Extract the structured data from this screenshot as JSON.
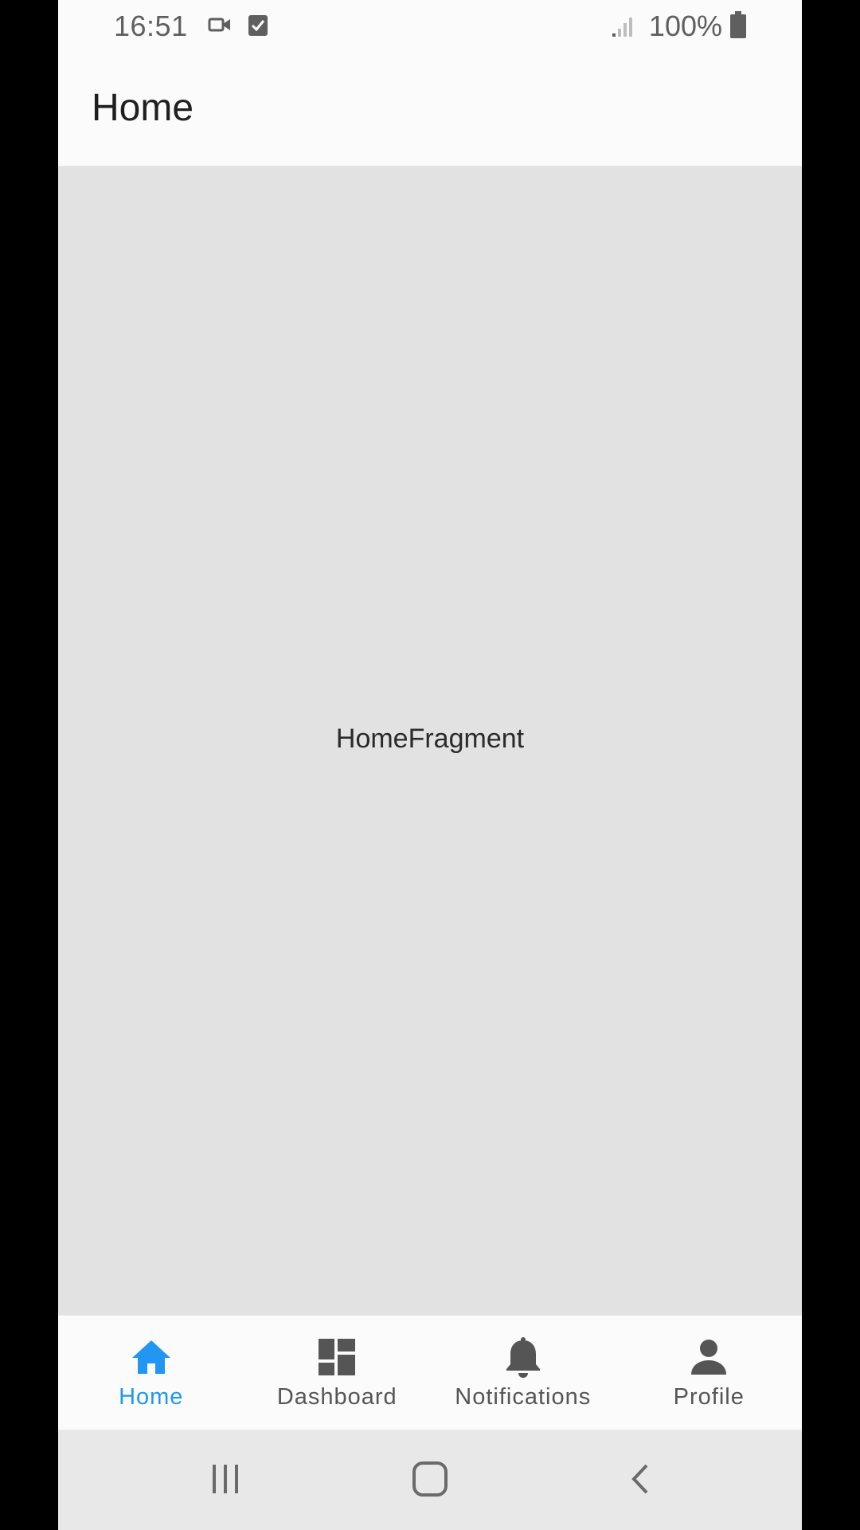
{
  "status_bar": {
    "time": "16:51",
    "battery_percent": "100%",
    "icons": [
      "video-camera-icon",
      "checkbox-icon",
      "signal-icon",
      "battery-icon"
    ]
  },
  "app_bar": {
    "title": "Home"
  },
  "content": {
    "label": "HomeFragment"
  },
  "bottom_nav": {
    "items": [
      {
        "label": "Home",
        "icon": "home-icon",
        "active": true
      },
      {
        "label": "Dashboard",
        "icon": "dashboard-icon",
        "active": false
      },
      {
        "label": "Notifications",
        "icon": "bell-icon",
        "active": false
      },
      {
        "label": "Profile",
        "icon": "person-icon",
        "active": false
      }
    ]
  },
  "system_nav": {
    "buttons": [
      "recent-apps-icon",
      "home-button-icon",
      "back-icon"
    ]
  },
  "colors": {
    "accent": "#2196f3",
    "inactive": "#555555",
    "content_bg": "#e2e2e2"
  }
}
